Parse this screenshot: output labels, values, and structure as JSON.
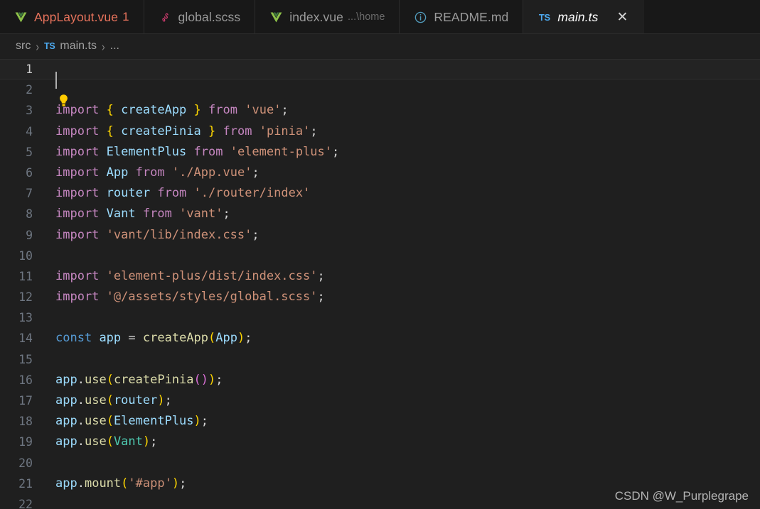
{
  "colors": {
    "editor_background": "#1f1f1f",
    "tabbar_background": "#181818",
    "active_tab_background": "#1f1f1f",
    "current_line_background": "#232323",
    "keyword": "#c586c0",
    "declaration": "#569cd6",
    "variable": "#9cdcfe",
    "string": "#ce9178",
    "function": "#dcdcaa",
    "class": "#4ec9b0",
    "bracket_level_1": "#ffd700",
    "bracket_level_2": "#da70d6",
    "line_number": "#6e7681",
    "active_line_number": "#cccccc",
    "modified_tab_text": "#e8735c",
    "ts_icon_blue": "#4daaf0",
    "vue_icon_green": "#8dc149",
    "scss_icon_pink": "#e8407a",
    "md_icon_blue": "#519aba"
  },
  "tabbar": {
    "tabs": [
      {
        "label": "AppLayout.vue",
        "icon": "vue-icon",
        "badge": "1",
        "sub": "",
        "active": false,
        "modified": true,
        "closable": false
      },
      {
        "label": "global.scss",
        "icon": "sass-icon",
        "badge": "",
        "sub": "",
        "active": false,
        "modified": false,
        "closable": false
      },
      {
        "label": "index.vue",
        "icon": "vue-icon",
        "badge": "",
        "sub": "...\\home",
        "active": false,
        "modified": false,
        "closable": false
      },
      {
        "label": "README.md",
        "icon": "markdown-info-icon",
        "badge": "",
        "sub": "",
        "active": false,
        "modified": false,
        "closable": false
      },
      {
        "label": "main.ts",
        "icon": "typescript-icon",
        "badge": "",
        "sub": "",
        "active": true,
        "modified": false,
        "closable": true,
        "close_label": "✕"
      }
    ]
  },
  "breadcrumb": {
    "items": [
      {
        "text": "src",
        "icon": ""
      },
      {
        "text": "main.ts",
        "icon": "typescript-icon"
      },
      {
        "text": "...",
        "icon": ""
      }
    ],
    "separator": "›"
  },
  "editor": {
    "language": "typescript",
    "file_name": "main.ts",
    "active_line": 1,
    "cursor_line": 1,
    "cursor_column": 1,
    "lightbulb_line": 2,
    "total_visible_lines": 22,
    "lines": [
      {
        "n": "1",
        "text": ""
      },
      {
        "n": "2",
        "text": ""
      },
      {
        "n": "3",
        "text": "import { createApp } from 'vue';"
      },
      {
        "n": "4",
        "text": "import { createPinia } from 'pinia';"
      },
      {
        "n": "5",
        "text": "import ElementPlus from 'element-plus';"
      },
      {
        "n": "6",
        "text": "import App from './App.vue';"
      },
      {
        "n": "7",
        "text": "import router from './router/index'"
      },
      {
        "n": "8",
        "text": "import Vant from 'vant';"
      },
      {
        "n": "9",
        "text": "import 'vant/lib/index.css';"
      },
      {
        "n": "10",
        "text": ""
      },
      {
        "n": "11",
        "text": "import 'element-plus/dist/index.css';"
      },
      {
        "n": "12",
        "text": "import '@/assets/styles/global.scss';"
      },
      {
        "n": "13",
        "text": ""
      },
      {
        "n": "14",
        "text": "const app = createApp(App);"
      },
      {
        "n": "15",
        "text": ""
      },
      {
        "n": "16",
        "text": "app.use(createPinia());"
      },
      {
        "n": "17",
        "text": "app.use(router);"
      },
      {
        "n": "18",
        "text": "app.use(ElementPlus);"
      },
      {
        "n": "19",
        "text": "app.use(Vant);"
      },
      {
        "n": "20",
        "text": ""
      },
      {
        "n": "21",
        "text": "app.mount('#app');"
      },
      {
        "n": "22",
        "text": ""
      }
    ]
  },
  "watermark": {
    "text": "CSDN @W_Purplegrape"
  }
}
